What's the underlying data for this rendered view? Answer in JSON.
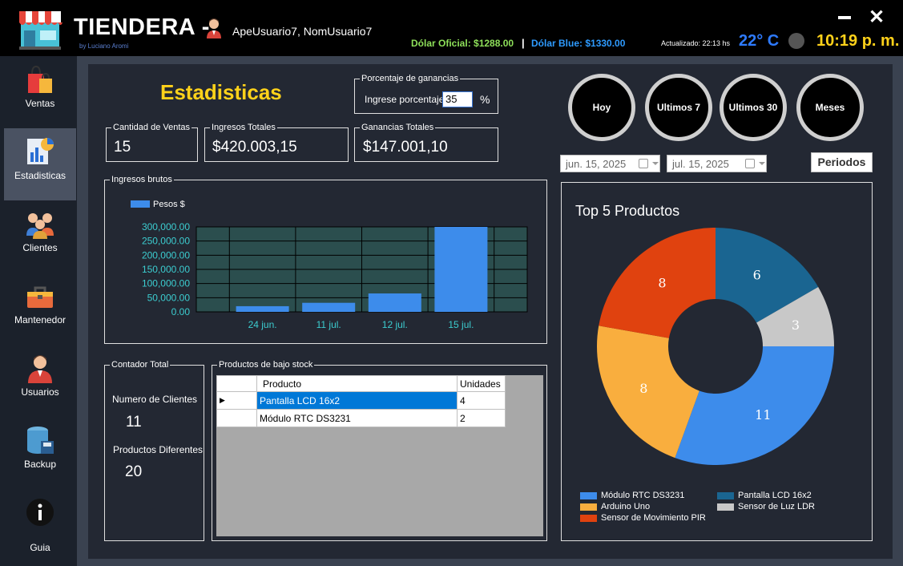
{
  "header": {
    "app_title": "TIENDERA -",
    "author": "by Luciano Aromi",
    "user": "ApeUsuario7, NomUsuario7",
    "dolar_oficial": "Dólar Oficial: $1288.00",
    "separator": "|",
    "dolar_blue": "Dólar Blue: $1330.00",
    "updated": "Actualizado: 22:13 hs",
    "temperature": "22°  C",
    "clock": "10:19 p. m.",
    "minimize_icon": "minimize-icon",
    "close_icon": "close-icon",
    "close_label": "✕"
  },
  "sidebar": {
    "items": [
      {
        "label": "Ventas",
        "icon": "shopping-bags-icon"
      },
      {
        "label": "Estadisticas",
        "icon": "chart-icon"
      },
      {
        "label": "Clientes",
        "icon": "users-group-icon"
      },
      {
        "label": "Mantenedor",
        "icon": "toolbox-icon"
      },
      {
        "label": "Usuarios",
        "icon": "user-icon"
      },
      {
        "label": "Backup",
        "icon": "database-save-icon"
      },
      {
        "label": "Guia",
        "icon": "info-icon"
      }
    ],
    "active": "Estadisticas"
  },
  "stats": {
    "title": "Estadisticas",
    "porcentaje": {
      "legend": "Porcentaje de ganancias",
      "label": "Ingrese porcentaje:",
      "value": "35",
      "unit": "%"
    },
    "cantidad": {
      "legend": "Cantidad de Ventas",
      "value": "15"
    },
    "ingresos": {
      "legend": "Ingresos Totales",
      "value": "$420.003,15"
    },
    "ganancias": {
      "legend": "Ganancias Totales",
      "value": "$147.001,10"
    }
  },
  "filters": {
    "buttons": [
      "Hoy",
      "Ultimos 7",
      "Ultimos 30",
      "Meses"
    ],
    "date_from": "jun.  15, 2025",
    "date_to": "jul.   15, 2025",
    "periodos": "Periodos"
  },
  "ingresos_chart": {
    "legend": "Ingresos brutos",
    "series_label": "Pesos $"
  },
  "contador": {
    "legend": "Contador Total",
    "clientes_label": "Numero de Clientes",
    "clientes_value": "11",
    "productos_label": "Productos Diferentes",
    "productos_value": "20"
  },
  "bajo_stock": {
    "legend": "Productos de bajo stock",
    "columns": [
      "Producto",
      "Unidades"
    ],
    "rows": [
      {
        "producto": "Pantalla LCD 16x2",
        "unidades": "4"
      },
      {
        "producto": "Módulo RTC DS3231",
        "unidades": "2"
      }
    ]
  },
  "top5": {
    "title": "Top 5 Productos",
    "legend": [
      {
        "name": "Módulo RTC DS3231",
        "color": "#3d8ceb"
      },
      {
        "name": "Pantalla LCD 16x2",
        "color": "#1a6591"
      },
      {
        "name": "Arduino Uno",
        "color": "#f9ae3e"
      },
      {
        "name": "Sensor de Luz LDR",
        "color": "#c8c8c8"
      },
      {
        "name": "Sensor de Movimiento PIR",
        "color": "#e0420f"
      }
    ]
  },
  "chart_data": [
    {
      "type": "bar",
      "categories": [
        "24 jun.",
        "11 jul.",
        "12 jul.",
        "15 jul."
      ],
      "series": [
        {
          "name": "Pesos $",
          "values": [
            20000,
            32000,
            65000,
            300000
          ]
        }
      ],
      "ylim": [
        0,
        300000
      ],
      "yticks": [
        "300,000.00",
        "250,000.00",
        "200,000.00",
        "150,000.00",
        "100,000.00",
        "50,000.00",
        "0.00"
      ],
      "legend_position": "top-left",
      "grid": true
    },
    {
      "type": "pie",
      "title": "Top 5 Productos",
      "categories": [
        "Pantalla LCD 16x2",
        "Sensor de Luz LDR",
        "Módulo RTC DS3231",
        "Arduino Uno",
        "Sensor de Movimiento PIR"
      ],
      "values": [
        6,
        3,
        11,
        8,
        8
      ],
      "colors": [
        "#1a6591",
        "#c8c8c8",
        "#3d8ceb",
        "#f9ae3e",
        "#e0420f"
      ],
      "legend_position": "bottom"
    }
  ]
}
